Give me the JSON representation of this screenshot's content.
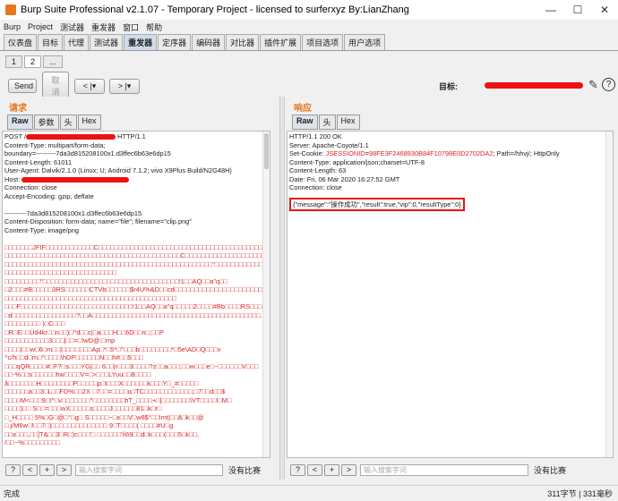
{
  "window": {
    "title": "Burp Suite Professional v2.1.07 - Temporary Project - licensed to surferxyz By:LianZhang",
    "minimize": "—",
    "maximize": "☐",
    "close": "✕"
  },
  "menu": [
    "Burp",
    "Project",
    "测试器",
    "重发器",
    "窗口",
    "帮助"
  ],
  "main_tabs": [
    "仪表盘",
    "目标",
    "代理",
    "测试器",
    "重发器",
    "定序器",
    "编码器",
    "对比器",
    "插件扩展",
    "项目选项",
    "用户选项"
  ],
  "active_main_tab": "重发器",
  "sub_tabs": [
    "1",
    "2",
    "..."
  ],
  "toolbar": {
    "send": "Send",
    "cancel": "取消",
    "back": "< |▾",
    "forward": "> |▾",
    "target_label": "目标:",
    "edit_icon": "pencil-icon",
    "help": "?"
  },
  "request": {
    "title": "请求",
    "tabs": [
      "Raw",
      "参数",
      "头",
      "Hex"
    ],
    "headers": [
      {
        "pre": "POST /",
        "post": " HTTP/1.1"
      },
      {
        "pre": "Content-Type: multipart/form-data;",
        "post": ""
      },
      {
        "pre": "boundary=---------7da3d815208100x1.d3ffec6b63e6dp15",
        "post": ""
      },
      {
        "pre": "Content-Length: 61011",
        "post": ""
      },
      {
        "pre": "User-Agent: Dalvik/2.1.0 (Linux; U; Android 7.1.2; vivo X9Plus Build/N2G48H)",
        "post": ""
      },
      {
        "pre": "Host: ",
        "post": ""
      },
      {
        "pre": "Connection: close",
        "post": ""
      },
      {
        "pre": "Accept-Encoding: gzip, deflate",
        "post": ""
      },
      {
        "pre": "",
        "post": ""
      },
      {
        "pre": "----------7da3d815208100x1.d3ffec6b63e6dp15",
        "post": ""
      },
      {
        "pre": "Content-Disposition: form-data; name=\"file\"; filename=\"clip.png\"",
        "post": ""
      },
      {
        "pre": "Content-Type: image/png",
        "post": ""
      }
    ],
    "body": [
      "□□□□□□□JFIF□□□□□□□□□□□□C□□□□□□□□□□□□□□□□□□□□□□□□□□□□□□□□□□□□□□□□□□□□",
      "□□□□□□□□□□□□□□□□□□□□□□□□□□□□□□□□□□□□□□□□□□□□C□□□□□□□□□□□□□□□□□□□□□",
      "□□□□□□□□□□□□□□□□□□□□□□□□□□□□□□□□□□□□□□□□□□□□□□□□□□□□\"□□□□□□□□□□□□□□□",
      "□□□□□□□□□□□□□□□□□□□□□□□□□□□□",
      "□□□□□□□□□\"□□□□□□□□□□□□□□□□□□□□□□□□□□□□□□□□□□!1□□AQ□□a\"q□□",
      "□2□□□#B□□□□□3RS□□□□□□CTVb□□□□□□$r4U%&D□□cd□□□□□□□□□□□□□□□□□□□□□□□",
      "□□□□□□□□□□□□□□□□□□□□□□□□□□□□□□□□□□□□□□□□□□□",
      "□□□F□□□□□□□□□□□□□□□□□□□□□□□□□□□□!1□□AQ□□a\"q□□□□□2□□□□#Bb□□□□RS□□□3r",
      "□d□□□□□□□□□□□□□□□□?□□A□□□□□□□□□□□□□□□□□□□□□□□□□□□□□□□□□□□□□□□□□□.",
      "□□□□□□□□□ )□C□□□",
      "□R□E□□Úd4kr□□n□□)□^d□□c|□a□□□H□□6D□□n□;□□P",
      "□□□□□□□□□□□3□□□|□□=□!wD@:□mp",
      "□□□□|□□w□6□m□□|□□□:□□□□Ap□*□5*□^□□□b□□□□□□□□*□5e\\AD□Q□□□v",
      "^c/h□□d□m□^□□□□\\hDP□□□□□□N□□h#□□5□□□",
      "□□□qQR□□□□#□F?□s□□□YG|□□ 6□□|r□□□3□□□□?z□□a□□□;□□w□□□e□~□□□□□□V□□□",
      "□□-%□□s□□□□□□hw□□□□V=□>□□□LYuu□□8□□□□",
      "å□□□□□□□H□□□□□□□□P□□□□□p□t□□□X□□□□□□k□□□Y□_#□□□□□",
      "□□□□□□à□□3□L□□FD%□□2X        □7□□=□□□□u□TC□□□□□□□□□□□□;□7□□d□□$",
      "□□□□M<□□□9□!^□v□□□□□□□^□□□□□□□□hT_□□□□+□|□□□□□□□\\VT□□□□!□M□",
      "□□□□)□□ S□□=□□□wX□□□□□s□□□□J□□□□□□81□k□r□",
      "□_H□□□□ 5%□G□@□°□g□ S□□□□□~□x□□V□w8$°□□!mt|□□å□k□□@",
      "□.j/M6w□!□□7□)□□□□□□□□□□□□□□ 9□T□□□□( □□□□#U□g",
      "□□x□□□,□□]T&□□3□R□)c□□□'□ □□□□□□'lí69□□d□k□□□(□□□5□k□□,",
      "/□□~%□□□□□□□□□"
    ],
    "search_placeholder": "输入搜索字词",
    "no_match": "没有比赛"
  },
  "response": {
    "title": "响应",
    "tabs": [
      "Raw",
      "头",
      "Hex"
    ],
    "lines": [
      "HTTP/1.1 200 OK",
      "Server: Apache-Coyote/1.1"
    ],
    "cookie_pre": "Set-Cookie: ",
    "cookie_name": "JSESSIONID",
    "cookie_eq": "=",
    "cookie_value": "98FE3F2468930B84F10798E0D2702DA2",
    "cookie_post": "; Path=/hhvj/; HttpOnly",
    "lines2": [
      "Content-Type: application/json;charset=UTF-8",
      "Content-Length: 63",
      "Date: Fri, 06 Mar 2020 16:27:52 GMT",
      "Connection: close"
    ],
    "json_body": "{\"message\":\"操作成功\",\"result\":true,\"vip\":0,\"resultType\":0}",
    "search_placeholder": "输入搜索字词",
    "no_match": "没有比赛"
  },
  "status": {
    "left": "完成",
    "right": "311字节 | 331毫秒"
  },
  "accent_color": "#e8761e",
  "redaction_color": "#ee1111"
}
